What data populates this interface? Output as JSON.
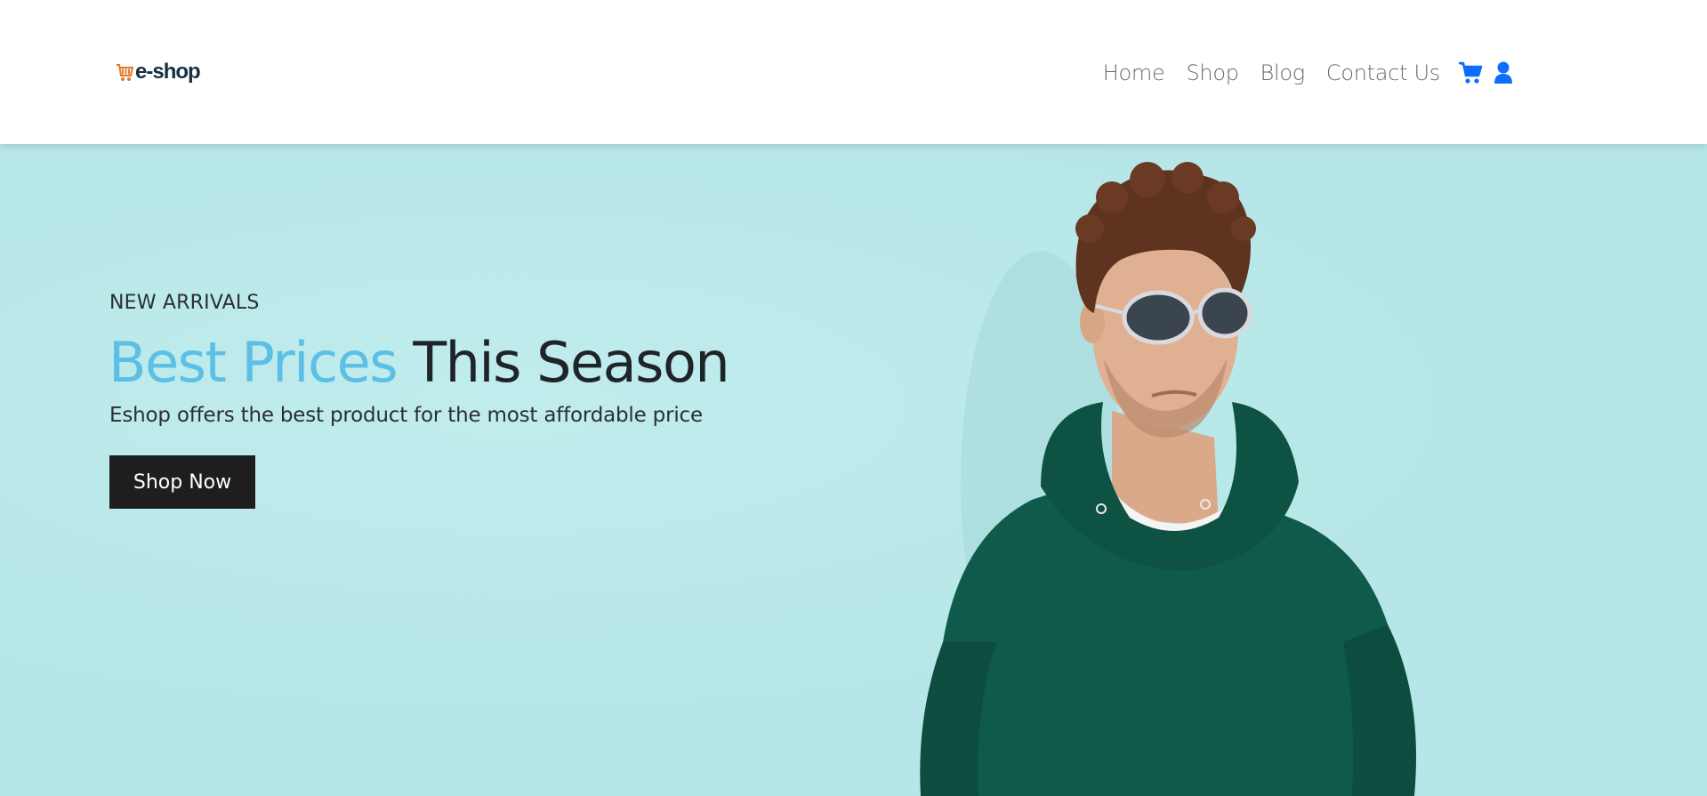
{
  "brand": {
    "logo_text": "e-shop"
  },
  "nav": {
    "items": [
      {
        "label": "Home"
      },
      {
        "label": "Shop"
      },
      {
        "label": "Blog"
      },
      {
        "label": "Contact Us"
      }
    ],
    "icons": [
      "cart-icon",
      "user-icon"
    ],
    "icon_color": "#0d6efd"
  },
  "hero": {
    "eyebrow": "NEW ARRIVALS",
    "headline_accent": "Best Prices",
    "headline_rest": " This Season",
    "subtitle": "Eshop offers the best product for the most affordable price",
    "cta_label": "Shop Now",
    "background_color": "#b6e6e7",
    "accent_color": "#5bbfe6"
  }
}
